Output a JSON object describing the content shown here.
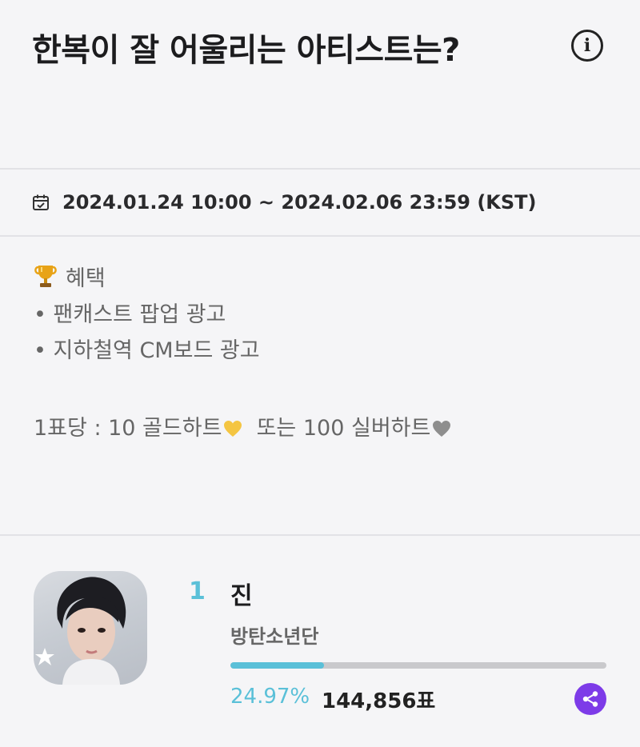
{
  "poll": {
    "title": "한복이 잘 어울리는 아티스트는?",
    "period": "2024.01.24 10:00 ~ 2024.02.06 23:59 (KST)"
  },
  "description": {
    "benefit_heading": "혜택",
    "benefits": [
      "• 팬캐스트 팝업 광고",
      "• 지하철역 CM보드 광고"
    ],
    "vote_cost_prefix": "1표당 : 10 골드하트",
    "vote_cost_suffix": "또는 100 실버하트"
  },
  "candidates": [
    {
      "rank": "1",
      "name": "진",
      "group": "방탄소년단",
      "percent_label": "24.97%",
      "percent_value": 24.97,
      "votes": "144,856표"
    }
  ],
  "colors": {
    "accent": "#5ac0d8",
    "share": "#7d3be8",
    "background": "#f5f5f7",
    "gold_heart": "#f4c542",
    "silver_heart": "#8e8e8e"
  },
  "icons": {
    "info": "info-icon",
    "calendar": "calendar-check-icon",
    "trophy": "trophy-icon",
    "gold_heart": "yellow-heart-icon",
    "silver_heart": "grey-heart-icon",
    "share": "share-icon"
  }
}
